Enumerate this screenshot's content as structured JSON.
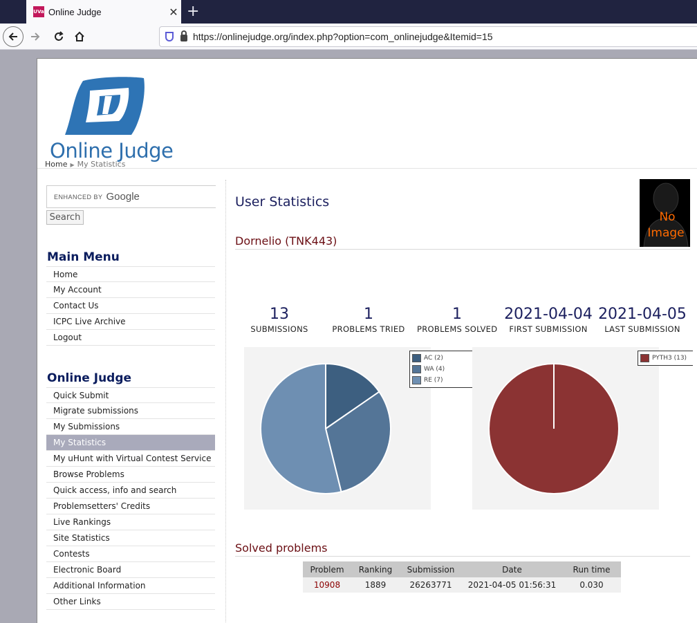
{
  "browser": {
    "tab_title": "Online Judge",
    "favicon_text": "UVa",
    "close_glyph": "✕",
    "newtab_glyph": "+",
    "url": "https://onlinejudge.org/index.php?option=com_onlinejudge&Itemid=15"
  },
  "header": {
    "logo_text": "Online Judge",
    "breadcrumb": [
      "Home",
      "My Statistics"
    ]
  },
  "search": {
    "enhanced_by": "ENHANCED BY",
    "google": "Google",
    "button": "Search"
  },
  "main_menu": {
    "title": "Main Menu",
    "items": [
      "Home",
      "My Account",
      "Contact Us",
      "ICPC Live Archive",
      "Logout"
    ]
  },
  "oj_menu": {
    "title": "Online Judge",
    "items": [
      "Quick Submit",
      "Migrate submissions",
      "My Submissions",
      "My Statistics",
      "My uHunt with Virtual Contest Service",
      "Browse Problems",
      "Quick access, info and search",
      "Problemsetters' Credits",
      "Live Rankings",
      "Site Statistics",
      "Contests",
      "Electronic Board",
      "Additional Information",
      "Other Links"
    ],
    "active_index": 3
  },
  "content": {
    "title": "User Statistics",
    "user": "Dornelio (TNK443)",
    "no_image": [
      "No",
      "Image"
    ],
    "stats": [
      {
        "value": "13",
        "label": "SUBMISSIONS"
      },
      {
        "value": "1",
        "label": "PROBLEMS TRIED"
      },
      {
        "value": "1",
        "label": "PROBLEMS SOLVED"
      },
      {
        "value": "2021-04-04",
        "label": "FIRST SUBMISSION"
      },
      {
        "value": "2021-04-05",
        "label": "LAST SUBMISSION"
      }
    ],
    "solved_title": "Solved problems",
    "table": {
      "headers": [
        "Problem",
        "Ranking",
        "Submission",
        "Date",
        "Run time"
      ],
      "rows": [
        [
          "10908",
          "1889",
          "26263771",
          "2021-04-05 01:56:31",
          "0.030"
        ]
      ]
    }
  },
  "colors": {
    "ac": "#3d5f80",
    "wa": "#547597",
    "re": "#6e8fb2",
    "pyth3": "#8b3333"
  },
  "chart_data": [
    {
      "type": "pie",
      "categories": [
        "AC (2)",
        "WA (4)",
        "RE (7)"
      ],
      "values": [
        2,
        4,
        7
      ],
      "legend_position": "top-right"
    },
    {
      "type": "pie",
      "categories": [
        "PYTH3 (13)"
      ],
      "values": [
        13
      ],
      "legend_position": "top-right"
    }
  ]
}
